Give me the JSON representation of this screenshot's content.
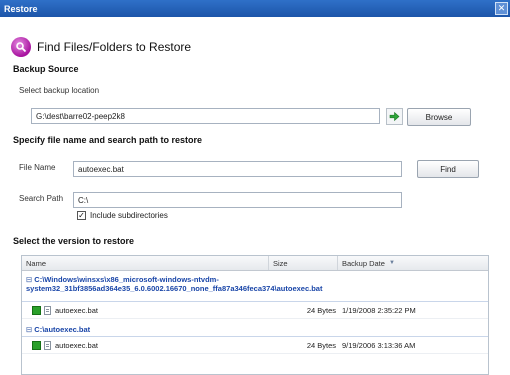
{
  "window": {
    "title": "Restore",
    "close_glyph": "✕"
  },
  "header": {
    "title": "Find Files/Folders to Restore",
    "icon": "search-icon"
  },
  "backup_source": {
    "section_label": "Backup Source",
    "location_label": "Select backup location",
    "location_value": "G:\\dest\\barre02-peep2k8",
    "go_icon": "arrow-right-icon",
    "browse_label": "Browse"
  },
  "search": {
    "section_label": "Specify file name and search path to restore",
    "file_name_label": "File Name",
    "file_name_value": "autoexec.bat",
    "find_label": "Find",
    "search_path_label": "Search Path",
    "search_path_value": "C:\\",
    "include_subdirs_label": "Include subdirectories",
    "include_subdirs_checked": true
  },
  "versions": {
    "section_label": "Select the version to restore",
    "columns": {
      "name": "Name",
      "size": "Size",
      "backup_date": "Backup Date",
      "sort_glyph": "▼"
    },
    "groups": [
      {
        "path": "C:\\Windows\\winsxs\\x86_microsoft-windows-ntvdm-system32_31bf3856ad364e35_6.0.6002.16670_none_ffa87a346feca374\\autoexec.bat",
        "toggle": "⊟",
        "files": [
          {
            "name": "autoexec.bat",
            "size": "24 Bytes",
            "date": "1/19/2008 2:35:22 PM"
          }
        ]
      },
      {
        "path": "C:\\autoexec.bat",
        "toggle": "⊟",
        "files": [
          {
            "name": "autoexec.bat",
            "size": "24 Bytes",
            "date": "9/19/2006 3:13:36 AM"
          }
        ]
      }
    ]
  },
  "colors": {
    "titlebar": "#1c55a9",
    "group_text": "#1a46a8",
    "accent_green": "#2aa02a"
  }
}
